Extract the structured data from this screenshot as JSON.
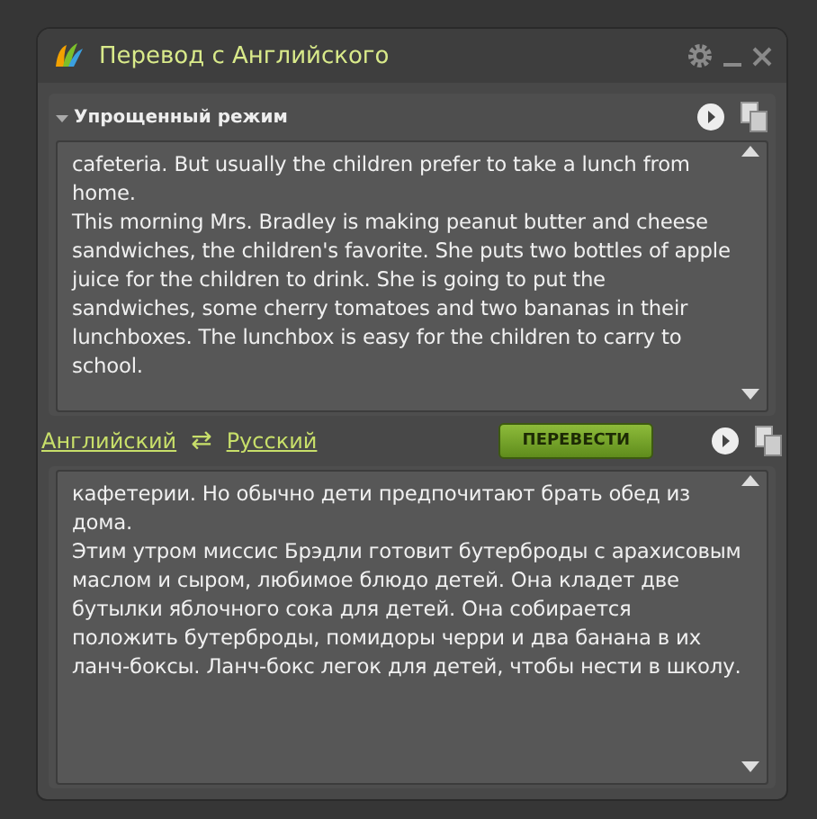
{
  "window": {
    "title": "Перевод с Английского"
  },
  "mode_toggle": {
    "label": "Упрощенный режим",
    "expanded": true
  },
  "source": {
    "lines": [
      "cafeteria. But usually the children prefer to take a lunch from",
      "home.",
      "This morning Mrs. Bradley is making peanut butter and cheese",
      "sandwiches, the children's favorite. She puts two bottles of apple",
      "juice for the children to drink. She is going to put the",
      "sandwiches, some cherry tomatoes and two bananas in their",
      "lunchboxes. The lunchbox is easy for the children to carry to",
      "school."
    ]
  },
  "languages": {
    "from": "Английский",
    "swap": "⇄",
    "to": "Русский"
  },
  "translate_button": "ПЕРЕВЕСТИ",
  "target": {
    "lines": [
      "кафетерии. Но обычно дети предпочитают брать обед из",
      "дома.",
      "Этим утром миссис Брэдли готовит бутерброды с арахисовым",
      "маслом и сыром, любимое блюдо детей. Она кладет две",
      "бутылки яблочного сока для детей. Она собирается",
      "положить бутерброды, помидоры черри и два банана в их",
      "ланч-боксы. Ланч-бокс легок для детей, чтобы нести в школу."
    ]
  }
}
